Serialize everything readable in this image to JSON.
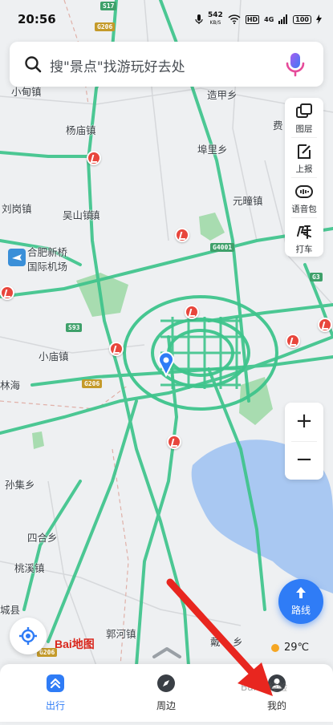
{
  "status_bar": {
    "time": "20:56",
    "network_speed": "542",
    "network_unit": "KB/S",
    "hd": "HD",
    "signal": "4G",
    "battery": "100"
  },
  "search": {
    "placeholder": "搜\"景点\"找游玩好去处"
  },
  "tools": [
    {
      "label": "图层",
      "icon": "layers-icon"
    },
    {
      "label": "上报",
      "icon": "report-icon"
    },
    {
      "label": "语音包",
      "icon": "voice-pack-icon"
    },
    {
      "label": "打车",
      "icon": "taxi-icon"
    }
  ],
  "zoom": {
    "in": "+",
    "out": "−"
  },
  "route": {
    "label": "路线"
  },
  "map_labels": [
    "小甸镇",
    "杨庙镇",
    "刘岗镇",
    "吴山镇",
    "合肥新桥",
    "国际机场",
    "小庙镇",
    "林海",
    "孙集乡",
    "四合乡",
    "桃溪镇",
    "城县",
    "郭河镇",
    "造甲乡",
    "费",
    "埠里乡",
    "元疃镇",
    "戴",
    "乡",
    "镇"
  ],
  "road_shields": [
    "S17",
    "G206",
    "G4001",
    "S93",
    "G206",
    "G3",
    "G206"
  ],
  "weather": {
    "temperature": "29℃"
  },
  "logo": {
    "text": "Bai地图"
  },
  "bottom_nav": [
    {
      "label": "出行",
      "icon": "travel-icon"
    },
    {
      "label": "周边",
      "icon": "compass-icon"
    },
    {
      "label": "我的",
      "icon": "profile-icon"
    }
  ],
  "colors": {
    "accent": "#2f7cf6",
    "road_green": "#3ec48c",
    "lake": "#a9c8f2",
    "park": "#a8dcb0",
    "construction": "#e8463c",
    "arrow": "#e8261f"
  },
  "watermark": "Baidu经验"
}
